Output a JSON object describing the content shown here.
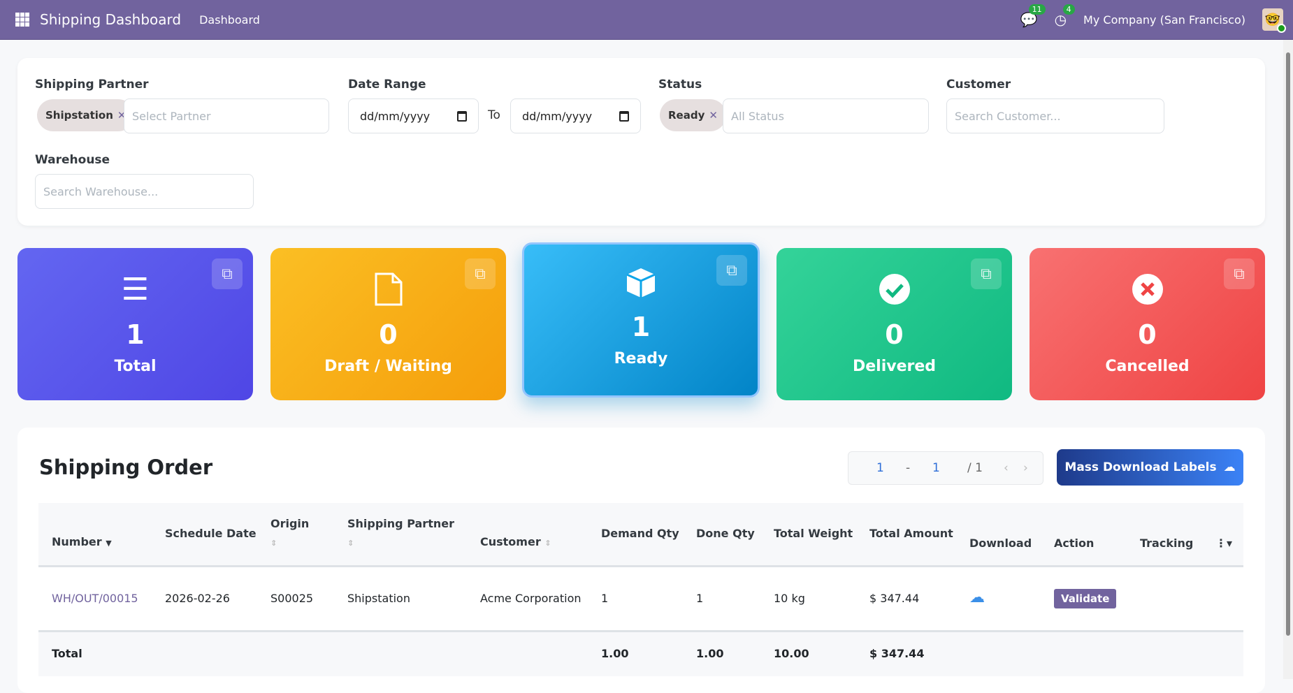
{
  "navbar": {
    "app_title": "Shipping Dashboard",
    "menu": "Dashboard",
    "messages_count": "11",
    "activities_count": "4",
    "company": "My Company (San Francisco)"
  },
  "filters": {
    "partner": {
      "label": "Shipping Partner",
      "tag": "Shipstation",
      "placeholder": "Select Partner"
    },
    "date": {
      "label": "Date Range",
      "from": "dd/mm/yyyy",
      "to_label": "To",
      "to": "dd/mm/yyyy"
    },
    "status": {
      "label": "Status",
      "tag": "Ready",
      "placeholder": "All Status"
    },
    "customer": {
      "label": "Customer",
      "placeholder": "Search Customer..."
    },
    "warehouse": {
      "label": "Warehouse",
      "placeholder": "Search Warehouse..."
    }
  },
  "cards": [
    {
      "count": "1",
      "label": "Total",
      "icon": "list-icon",
      "color": "#4f46e5"
    },
    {
      "count": "0",
      "label": "Draft / Waiting",
      "icon": "file-icon",
      "color": "#f59e0b"
    },
    {
      "count": "1",
      "label": "Ready",
      "icon": "cube-icon",
      "color": "#0284c7"
    },
    {
      "count": "0",
      "label": "Delivered",
      "icon": "check-circle-icon",
      "color": "#10b981"
    },
    {
      "count": "0",
      "label": "Cancelled",
      "icon": "times-circle-icon",
      "color": "#ef4444"
    }
  ],
  "orders": {
    "title": "Shipping Order",
    "pager": {
      "start": "1",
      "sep": "-",
      "end": "1",
      "total": "/ 1"
    },
    "mass_download": "Mass Download Labels",
    "columns": [
      "Number",
      "Schedule Date",
      "Origin",
      "Shipping Partner",
      "Customer",
      "Demand Qty",
      "Done Qty",
      "Total Weight",
      "Total Amount",
      "Download",
      "Action",
      "Tracking"
    ],
    "rows": [
      {
        "number": "WH/OUT/00015",
        "date": "2026-02-26",
        "origin": "S00025",
        "partner": "Shipstation",
        "customer": "Acme Corporation",
        "demand": "1",
        "done": "1",
        "weight": "10 kg",
        "amount": "$ 347.44",
        "action": "Validate"
      }
    ],
    "totals": {
      "label": "Total",
      "demand": "1.00",
      "done": "1.00",
      "weight": "10.00",
      "amount": "$ 347.44"
    }
  }
}
